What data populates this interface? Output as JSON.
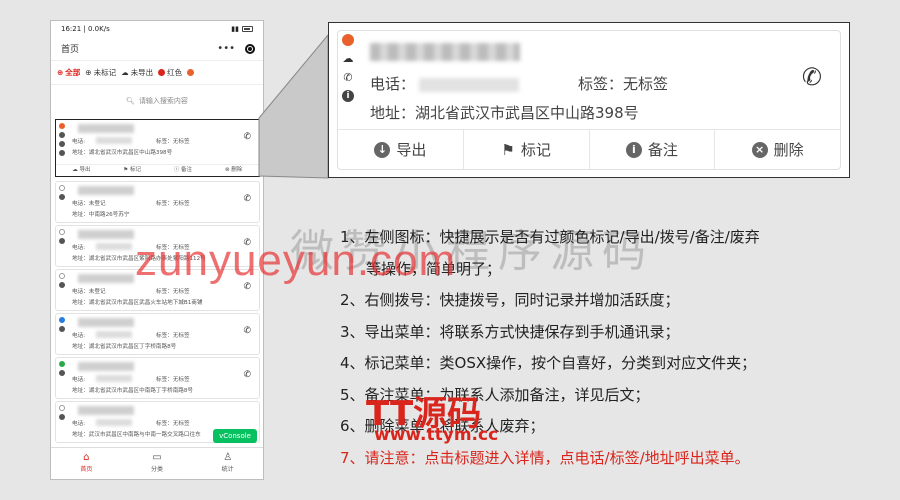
{
  "phone": {
    "status_time": "16:21 | 0.0K/s",
    "title": "首页",
    "menu_dots": "•••",
    "filters": [
      {
        "label": "全部",
        "active": true
      },
      {
        "label": "未标记"
      },
      {
        "label": "未导出"
      },
      {
        "label": "红色",
        "color": "#d9251c"
      }
    ],
    "search_placeholder": "请输入搜索内容",
    "cards": [
      {
        "phone_label": "电话:",
        "tag": "标签：无标签",
        "address": "地址：湖北省武汉市武昌区中山路398号",
        "actions": [
          "导出",
          "标记",
          "备注",
          "删除"
        ]
      },
      {
        "phone_label": "电话：未登记",
        "tag": "标签：无标签",
        "address": "地址：中南路26号苏宁"
      },
      {
        "phone_label": "电话:",
        "tag": "标签：无标签",
        "address": "地址：湖北省武汉市武昌区紫阳路办事处紫阳路112号"
      },
      {
        "phone_label": "电话：未登记",
        "tag": "标签：无标签",
        "address": "地址：湖北省武汉市武昌区武昌火车站地下城B1商铺"
      },
      {
        "phone_label": "电话:",
        "tag": "标签：无标签",
        "address": "地址：湖北省武汉市武昌区丁字桥南路8号"
      },
      {
        "phone_label": "电话:",
        "tag": "标签：无标签",
        "address": "地址：湖北省武汉市武昌区中南路丁字桥南路8号"
      },
      {
        "phone_label": "电话:",
        "tag": "标签：无标签",
        "address": "地址：武汉市武昌区中南路与中南一路交叉路口往东"
      }
    ],
    "vconsole": "vConsole",
    "tabs": [
      "首页",
      "分类",
      "统计"
    ]
  },
  "zoom": {
    "phone_label": "电话：",
    "tag": "标签：无标签",
    "address": "地址：湖北省武汉市武昌区中山路398号",
    "actions": [
      {
        "icon": "cloud-download-icon",
        "label": "导出"
      },
      {
        "icon": "flag-icon",
        "label": "标记"
      },
      {
        "icon": "info-icon",
        "label": "备注"
      },
      {
        "icon": "close-icon",
        "label": "删除"
      }
    ]
  },
  "instructions": [
    "1、左侧图标：快捷展示是否有过颜色标记/导出/拨号/备注/废弃",
    "等操作，简单明了；",
    "2、右侧拨号：快捷拨号，同时记录并增加活跃度；",
    "3、导出菜单：将联系方式快捷保存到手机通讯录；",
    "4、标记菜单：类OSX操作，按个自喜好，分类到对应文件夹；",
    "5、备注菜单：为联系人添加备注，详见后文；",
    "6、删除菜单：将联系人废弃；",
    "7、请注意：点击标题进入详情，点电话/标签/地址呼出菜单。"
  ],
  "watermarks": {
    "grey": "微赞小程序源码",
    "domain": "zunyueyun.com",
    "brand": "TT源码",
    "url": "www.ttym.cc"
  },
  "colors": {
    "accent_red": "#d9251c",
    "vconsole_green": "#07c160",
    "orange_dot": "#e8612c"
  }
}
